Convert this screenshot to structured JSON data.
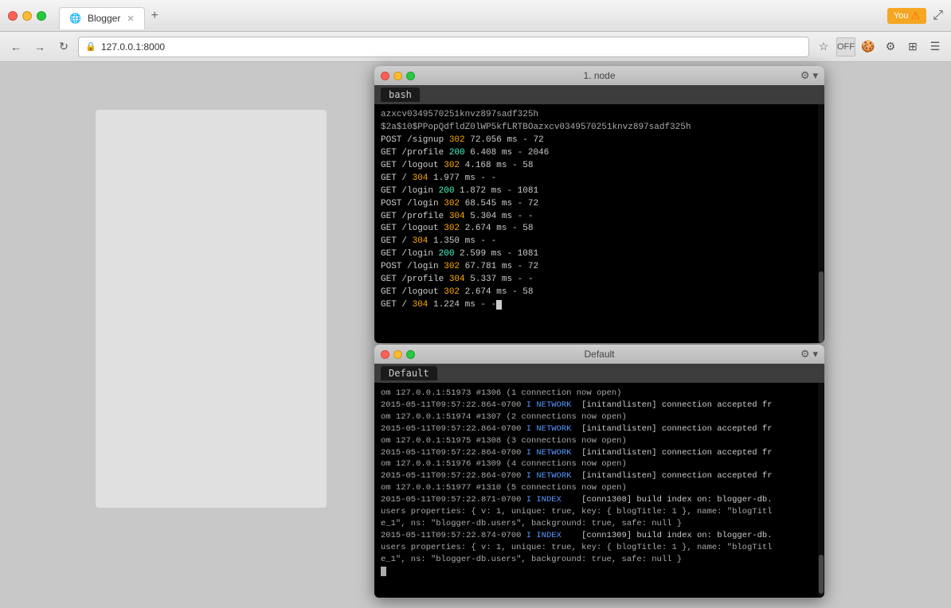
{
  "browser": {
    "tab_title": "Blogger",
    "url": "127.0.0.1:8000",
    "you_label": "You",
    "warning_icon": "⚠"
  },
  "terminal1": {
    "title": "1. node",
    "tab_label": "bash",
    "lines": [
      {
        "text": "azxcv0349570251knvz897sadf325h",
        "type": "plain"
      },
      {
        "text": "$2a$10$PPopQdfldZ0lWP5kfLRTBOazxcv0349570251knvz897sadf325h",
        "type": "plain"
      },
      {
        "text": "POST /signup 302 72.056 ms - 72",
        "parts": [
          {
            "t": "POST /signup ",
            "c": "plain"
          },
          {
            "t": "302",
            "c": "status-302"
          },
          {
            "t": " 72.056 ms - 72",
            "c": "plain"
          }
        ]
      },
      {
        "text": "GET /profile 200 6.408 ms - 2046",
        "parts": [
          {
            "t": "GET /profile ",
            "c": "plain"
          },
          {
            "t": "200",
            "c": "status-200"
          },
          {
            "t": " 6.408 ms - 2046",
            "c": "plain"
          }
        ]
      },
      {
        "text": "GET /logout 302 4.168 ms - 58",
        "parts": [
          {
            "t": "GET /logout ",
            "c": "plain"
          },
          {
            "t": "302",
            "c": "status-302"
          },
          {
            "t": " 4.168 ms - 58",
            "c": "plain"
          }
        ]
      },
      {
        "text": "GET / 304 1.977 ms - -",
        "parts": [
          {
            "t": "GET / ",
            "c": "plain"
          },
          {
            "t": "304",
            "c": "status-304"
          },
          {
            "t": " 1.977 ms - -",
            "c": "plain"
          }
        ]
      },
      {
        "text": "GET /login 200 1.872 ms - 1081",
        "parts": [
          {
            "t": "GET /login ",
            "c": "plain"
          },
          {
            "t": "200",
            "c": "status-200"
          },
          {
            "t": " 1.872 ms - 1081",
            "c": "plain"
          }
        ]
      },
      {
        "text": "POST /login 302 68.545 ms - 72",
        "parts": [
          {
            "t": "POST /login ",
            "c": "plain"
          },
          {
            "t": "302",
            "c": "status-302"
          },
          {
            "t": " 68.545 ms - 72",
            "c": "plain"
          }
        ]
      },
      {
        "text": "GET /profile 304 5.304 ms - -",
        "parts": [
          {
            "t": "GET /profile ",
            "c": "plain"
          },
          {
            "t": "304",
            "c": "status-304"
          },
          {
            "t": " 5.304 ms - -",
            "c": "plain"
          }
        ]
      },
      {
        "text": "GET /logout 302 2.674 ms - 58",
        "parts": [
          {
            "t": "GET /logout ",
            "c": "plain"
          },
          {
            "t": "302",
            "c": "status-302"
          },
          {
            "t": " 2.674 ms - 58",
            "c": "plain"
          }
        ]
      },
      {
        "text": "GET / 304 1.350 ms - -",
        "parts": [
          {
            "t": "GET / ",
            "c": "plain"
          },
          {
            "t": "304",
            "c": "status-304"
          },
          {
            "t": " 1.350 ms - -",
            "c": "plain"
          }
        ]
      },
      {
        "text": "GET /login 200 2.599 ms - 1081",
        "parts": [
          {
            "t": "GET /login ",
            "c": "plain"
          },
          {
            "t": "200",
            "c": "status-200"
          },
          {
            "t": " 2.599 ms - 1081",
            "c": "plain"
          }
        ]
      },
      {
        "text": "POST /login 302 67.781 ms - 72",
        "parts": [
          {
            "t": "POST /login ",
            "c": "plain"
          },
          {
            "t": "302",
            "c": "status-302"
          },
          {
            "t": " 67.781 ms - 72",
            "c": "plain"
          }
        ]
      },
      {
        "text": "GET /profile 304 5.337 ms - -",
        "parts": [
          {
            "t": "GET /profile ",
            "c": "plain"
          },
          {
            "t": "304",
            "c": "status-304"
          },
          {
            "t": " 5.337 ms - -",
            "c": "plain"
          }
        ]
      },
      {
        "text": "GET /logout 302 2.674 ms - 58",
        "parts": [
          {
            "t": "GET /logout ",
            "c": "plain"
          },
          {
            "t": "302",
            "c": "status-302"
          },
          {
            "t": " 2.674 ms - 58",
            "c": "plain"
          }
        ]
      },
      {
        "text": "GET / 304 1.224 ms - -",
        "parts": [
          {
            "t": "GET / ",
            "c": "plain"
          },
          {
            "t": "304",
            "c": "status-304"
          },
          {
            "t": " 1.224 ms - -",
            "c": "plain"
          }
        ]
      }
    ]
  },
  "terminal2": {
    "title": "Default",
    "tab_label": "Default",
    "lines": [
      "om 127.0.0.1:51973 #1306 (1 connection now open)",
      "2015-05-11T09:57:22.864-0700 I NETWORK  [initandlisten] connection accepted fr",
      "om 127.0.0.1:51974 #1307 (2 connections now open)",
      "2015-05-11T09:57:22.864-0700 I NETWORK  [initandlisten] connection accepted fr",
      "om 127.0.0.1:51975 #1308 (3 connections now open)",
      "2015-05-11T09:57:22.864-0700 I NETWORK  [initandlisten] connection accepted fr",
      "om 127.0.0.1:51976 #1309 (4 connections now open)",
      "2015-05-11T09:57:22.864-0700 I NETWORK  [initandlisten] connection accepted fr",
      "om 127.0.0.1:51977 #1310 (5 connections now open)",
      "2015-05-11T09:57:22.871-0700 I INDEX    [conn1308] build index on: blogger-db.",
      "users properties: { v: 1, unique: true, key: { blogTitle: 1 }, name: \"blogTitl",
      "e_1\", ns: \"blogger-db.users\", background: true, safe: null }",
      "2015-05-11T09:57:22.874-0700 I INDEX    [conn1309] build index on: blogger-db.",
      "users properties: { v: 1, unique: true, key: { blogTitle: 1 }, name: \"blogTitl",
      "e_1\", ns: \"blogger-db.users\", background: true, safe: null }"
    ]
  },
  "nav": {
    "back_title": "back",
    "forward_title": "forward",
    "refresh_title": "refresh"
  }
}
